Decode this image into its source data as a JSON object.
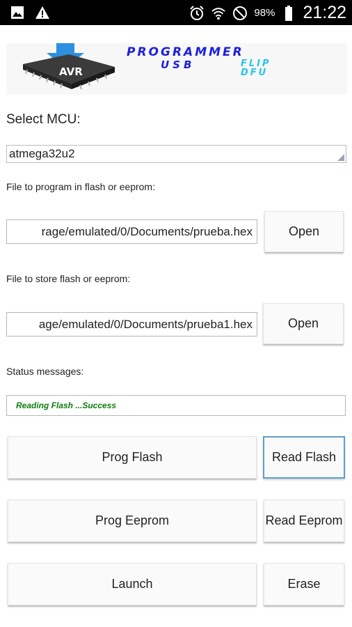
{
  "status_bar": {
    "battery_percent": "98%",
    "time": "21:22",
    "icons": [
      "image-icon",
      "warning-icon",
      "alarm-icon",
      "wifi-icon",
      "do-not-disturb-icon",
      "battery-icon"
    ]
  },
  "banner": {
    "chip_label": "AVR",
    "title": "PROGRAMMER",
    "subtitle": "USB",
    "flip": "FLIP",
    "dfu": "DFU"
  },
  "mcu": {
    "label": "Select MCU:",
    "selected": "atmega32u2"
  },
  "program_file": {
    "label": "File to program in flash or eeprom:",
    "value": "rage/emulated/0/Documents/prueba.hex",
    "open_label": "Open"
  },
  "store_file": {
    "label": "File to store flash or eeprom:",
    "value": "age/emulated/0/Documents/prueba1.hex",
    "open_label": "Open"
  },
  "status": {
    "label": "Status messages:",
    "message": "Reading Flash ...Success",
    "message_color": "#0f7d0f"
  },
  "actions": {
    "prog_flash": "Prog Flash",
    "read_flash": "Read Flash",
    "prog_eeprom": "Prog Eeprom",
    "read_eeprom": "Read Eeprom",
    "launch": "Launch",
    "erase": "Erase"
  }
}
